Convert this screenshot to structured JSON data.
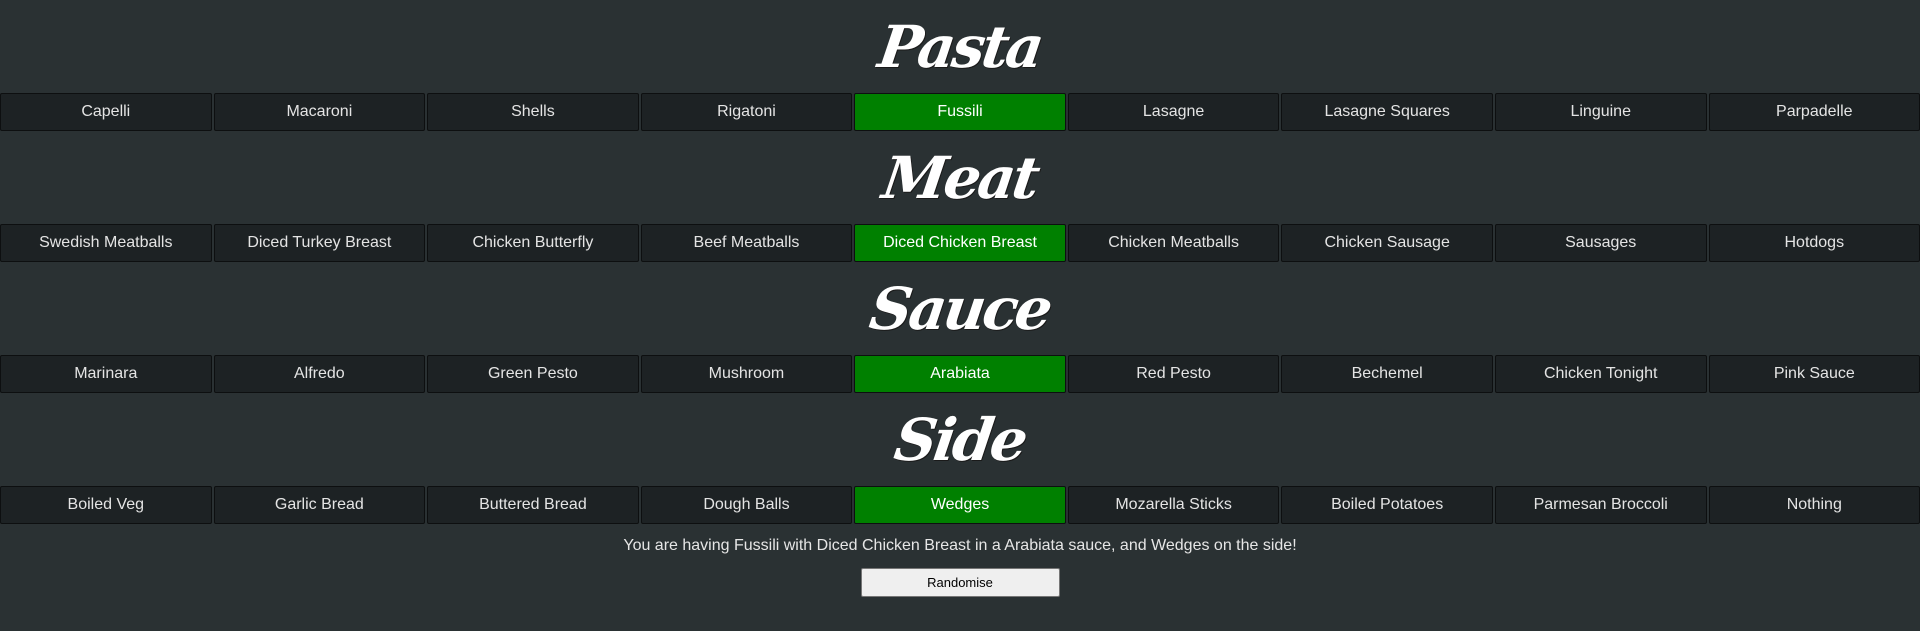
{
  "sections": [
    {
      "title": "Pasta",
      "options": [
        "Capelli",
        "Macaroni",
        "Shells",
        "Rigatoni",
        "Fussili",
        "Lasagne",
        "Lasagne Squares",
        "Linguine",
        "Parpadelle"
      ],
      "selected_index": 4
    },
    {
      "title": "Meat",
      "options": [
        "Swedish Meatballs",
        "Diced Turkey Breast",
        "Chicken Butterfly",
        "Beef Meatballs",
        "Diced Chicken Breast",
        "Chicken Meatballs",
        "Chicken Sausage",
        "Sausages",
        "Hotdogs"
      ],
      "selected_index": 4
    },
    {
      "title": "Sauce",
      "options": [
        "Marinara",
        "Alfredo",
        "Green Pesto",
        "Mushroom",
        "Arabiata",
        "Red Pesto",
        "Bechemel",
        "Chicken Tonight",
        "Pink Sauce"
      ],
      "selected_index": 4
    },
    {
      "title": "Side",
      "options": [
        "Boiled Veg",
        "Garlic Bread",
        "Buttered Bread",
        "Dough Balls",
        "Wedges",
        "Mozarella Sticks",
        "Boiled Potatoes",
        "Parmesan Broccoli",
        "Nothing"
      ],
      "selected_index": 4
    }
  ],
  "summary": "You are having Fussili with Diced Chicken Breast in a Arabiata sauce, and Wedges on the side!",
  "randomise_label": "Randomise",
  "colors": {
    "background": "#2a3133",
    "option_bg": "#1d2224",
    "selected_bg": "#008000"
  }
}
